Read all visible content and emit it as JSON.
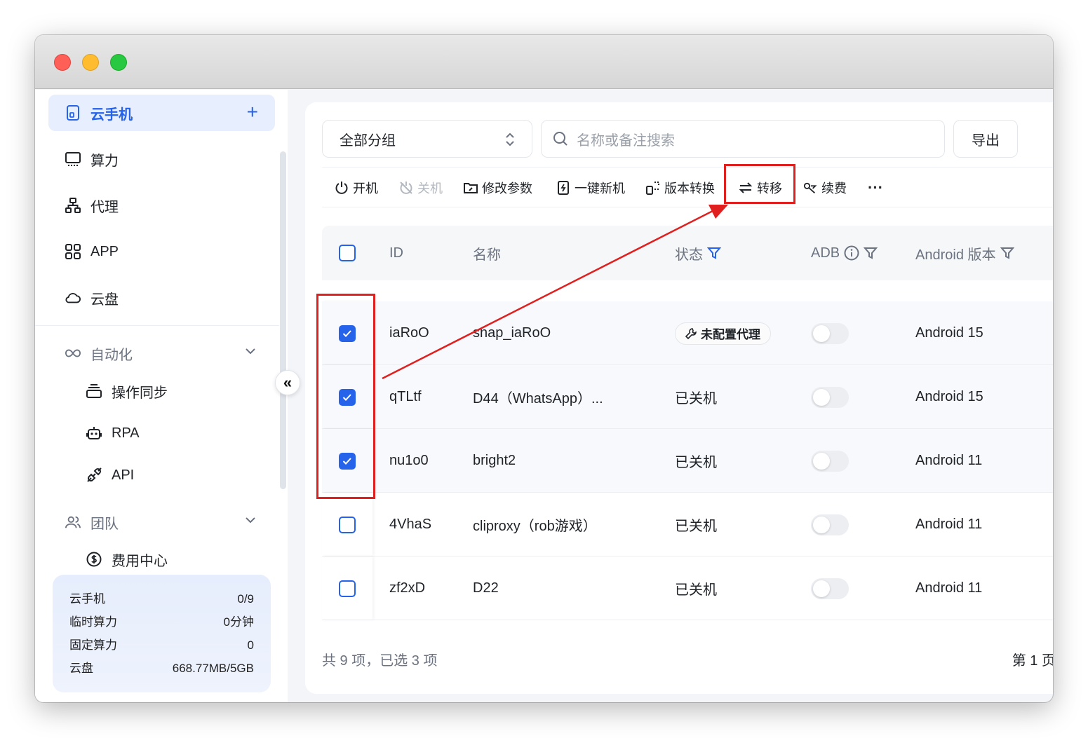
{
  "sidebar": {
    "items": [
      {
        "label": "云手机",
        "icon": "phone-icon",
        "active": true
      },
      {
        "label": "算力",
        "icon": "monitor-icon"
      },
      {
        "label": "代理",
        "icon": "network-icon"
      },
      {
        "label": "APP",
        "icon": "apps-grid-icon"
      },
      {
        "label": "云盘",
        "icon": "cloud-icon"
      }
    ],
    "add_label": "+",
    "groups": [
      {
        "label": "自动化",
        "icon": "infinity-icon",
        "children": [
          {
            "label": "操作同步",
            "icon": "stack-icon"
          },
          {
            "label": "RPA",
            "icon": "robot-icon"
          },
          {
            "label": "API",
            "icon": "plug-icon"
          }
        ]
      },
      {
        "label": "团队",
        "icon": "team-icon",
        "children": [
          {
            "label": "费用中心",
            "icon": "dollar-icon"
          }
        ]
      }
    ],
    "collapse_glyph": "«",
    "usage": [
      {
        "label": "云手机",
        "value": "0/9"
      },
      {
        "label": "临时算力",
        "value": "0分钟"
      },
      {
        "label": "固定算力",
        "value": "0"
      },
      {
        "label": "云盘",
        "value": "668.77MB/5GB"
      }
    ]
  },
  "filters": {
    "group_select": "全部分组",
    "search_placeholder": "名称或备注搜索",
    "export_label": "导出"
  },
  "toolbar": {
    "items": [
      {
        "label": "开机",
        "icon": "power-icon"
      },
      {
        "label": "关机",
        "icon": "power-off-icon",
        "disabled": true
      },
      {
        "label": "修改参数",
        "icon": "folder-edit-icon"
      },
      {
        "label": "一键新机",
        "icon": "flash-phone-icon"
      },
      {
        "label": "版本转换",
        "icon": "convert-icon"
      },
      {
        "label": "转移",
        "icon": "transfer-icon"
      },
      {
        "label": "续费",
        "icon": "renew-icon"
      }
    ],
    "more_label": "···"
  },
  "table": {
    "headers": {
      "id": "ID",
      "name": "名称",
      "status": "状态",
      "adb": "ADB",
      "android": "Android 版本"
    },
    "rows": [
      {
        "id": "iaRoO",
        "name": "snap_iaRoO",
        "status": "未配置代理",
        "status_tag": true,
        "adb": false,
        "android": "Android 15",
        "checked": true
      },
      {
        "id": "qTLtf",
        "name": "D44（WhatsApp）...",
        "status": "已关机",
        "adb": false,
        "android": "Android 15",
        "checked": true
      },
      {
        "id": "nu1o0",
        "name": "bright2",
        "status": "已关机",
        "adb": false,
        "android": "Android 11",
        "checked": true
      },
      {
        "id": "4VhaS",
        "name": "cliproxy（rob游戏）",
        "status": "已关机",
        "adb": false,
        "android": "Android 11",
        "checked": false
      },
      {
        "id": "zf2xD",
        "name": "D22",
        "status": "已关机",
        "adb": false,
        "android": "Android 11",
        "checked": false
      }
    ]
  },
  "footer": {
    "summary": "共 9 项，已选 3 项",
    "page": "第 1 页，"
  },
  "colors": {
    "accent": "#2563eb",
    "annotation": "#e01f1f"
  }
}
